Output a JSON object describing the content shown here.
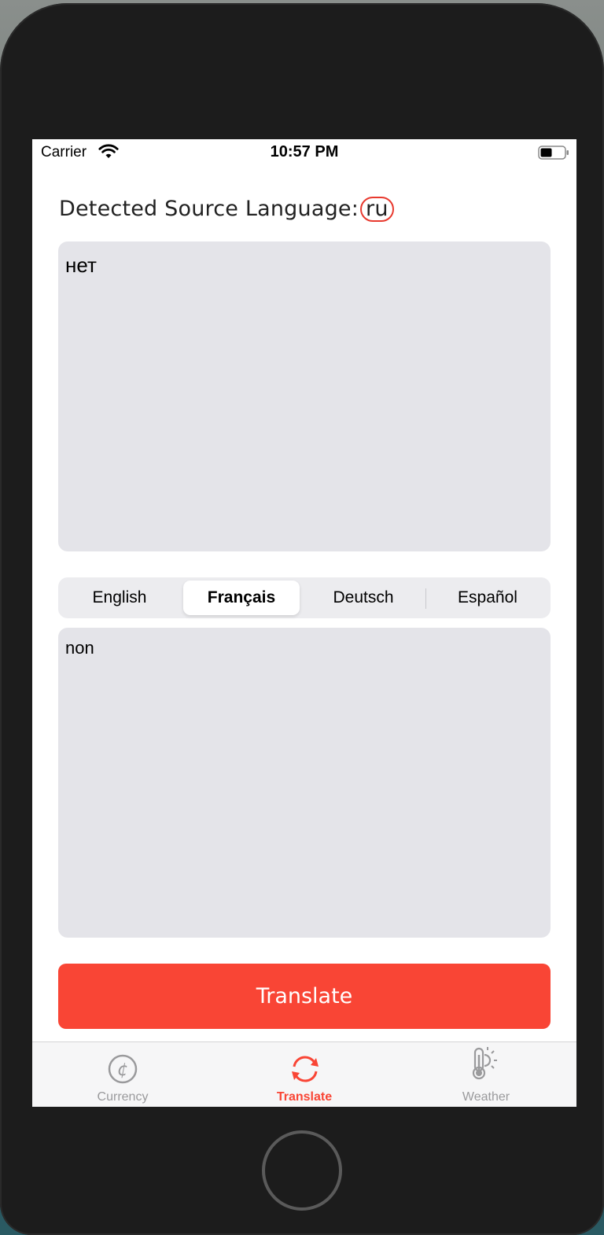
{
  "status_bar": {
    "carrier": "Carrier",
    "time": "10:57 PM"
  },
  "detected": {
    "label": "Detected Source Language:",
    "code": "ru"
  },
  "source_text": "нет",
  "languages": [
    {
      "label": "English",
      "selected": false
    },
    {
      "label": "Français",
      "selected": true
    },
    {
      "label": "Deutsch",
      "selected": false
    },
    {
      "label": "Español",
      "selected": false
    }
  ],
  "translated_text": "non",
  "translate_button": "Translate",
  "tabs": [
    {
      "label": "Currency",
      "icon": "currency-icon",
      "active": false
    },
    {
      "label": "Translate",
      "icon": "translate-icon",
      "active": true
    },
    {
      "label": "Weather",
      "icon": "weather-icon",
      "active": false
    }
  ],
  "colors": {
    "accent": "#f94535",
    "text_field_bg": "#e4e4e9",
    "inactive_tab": "#9a9a9c"
  }
}
